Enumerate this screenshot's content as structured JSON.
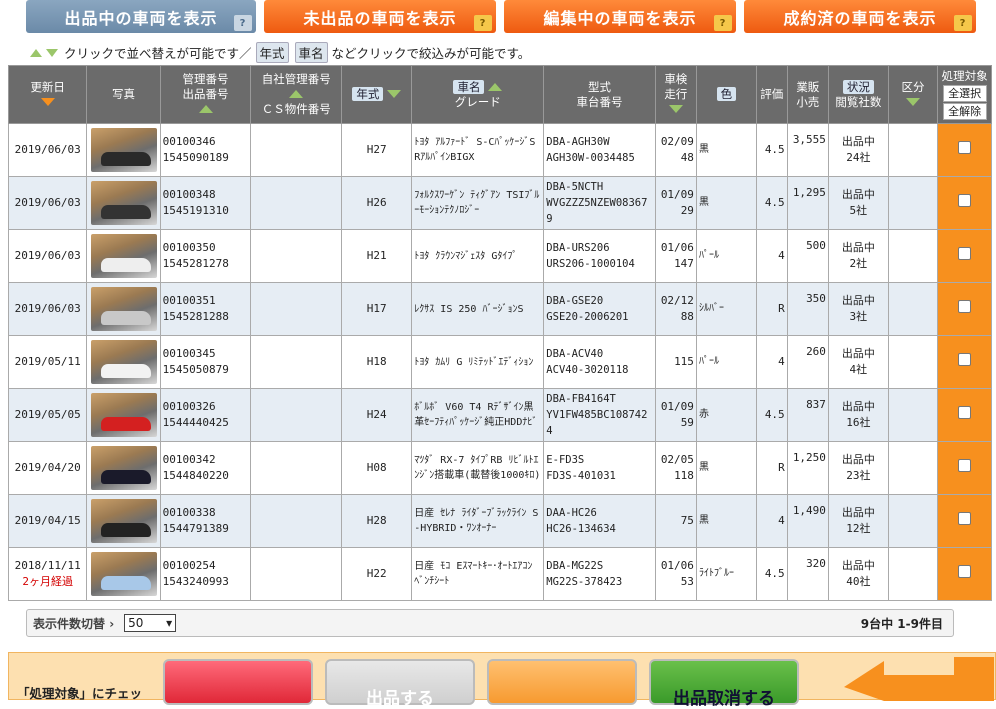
{
  "tabs": [
    {
      "label": "出品中の車両を表示",
      "icon": "help-badge-icon",
      "badge": "?",
      "active": true
    },
    {
      "label": "未出品の車両を表示",
      "icon": "help-badge-icon",
      "badge": "?",
      "active": false
    },
    {
      "label": "編集中の車両を表示",
      "icon": "help-badge-icon",
      "badge": "?",
      "active": false
    },
    {
      "label": "成約済の車両を表示",
      "icon": "help-badge-icon",
      "badge": "?",
      "active": false
    }
  ],
  "hint": {
    "part1": "クリックで並べ替えが可能です／",
    "chip1": "年式",
    "chip2": "車名",
    "part2": "などクリックで絞込みが可能です。"
  },
  "headers": {
    "updated": "更新日",
    "photo": "写真",
    "mgmt_no": "管理番号",
    "listing_no": "出品番号",
    "own_mgmt_no": "自社管理番号",
    "cs_no": "ＣＳ物件番号",
    "year": "年式",
    "car_name": "車名",
    "grade": "グレード",
    "model": "型式",
    "chassis": "車台番号",
    "inspection": "車検",
    "mileage": "走行",
    "color": "色",
    "rating": "評価",
    "sale": "業販",
    "retail": "小売",
    "status": "状況",
    "viewers": "閲覧社数",
    "category": "区分",
    "proc_target": "処理対象",
    "select_all": "全選択",
    "deselect_all": "全解除"
  },
  "rows": [
    {
      "updated": "2019/06/03",
      "updated_note": "",
      "mgmt": "00100346",
      "listing": "1545090189",
      "year": "H27",
      "grade": "ﾄﾖﾀ ｱﾙﾌｧｰﾄﾞ S-CﾊﾟｯｹｰｼﾞSRｱﾙﾊﾟｲﾝBIGX",
      "model": "DBA-AGH30W",
      "chassis": "AGH30W-0034485",
      "inspection": "02/09",
      "mileage": "48",
      "color": "黒",
      "rating": "4.5",
      "price": "3,555",
      "status": "出品中",
      "viewers": "24社",
      "car_color": "#2a2a2a"
    },
    {
      "updated": "2019/06/03",
      "updated_note": "",
      "mgmt": "00100348",
      "listing": "1545191310",
      "year": "H26",
      "grade": "ﾌｫﾙｸｽﾜｰｹﾞﾝ ﾃｨｸﾞｱﾝ TSIﾌﾞﾙｰﾓｰｼｮﾝﾃｸﾉﾛｼﾞｰ",
      "model": "DBA-5NCTH",
      "chassis": "WVGZZZ5NZEW083679",
      "inspection": "01/09",
      "mileage": "29",
      "color": "黒",
      "rating": "4.5",
      "price": "1,295",
      "status": "出品中",
      "viewers": "5社",
      "car_color": "#333333"
    },
    {
      "updated": "2019/06/03",
      "updated_note": "",
      "mgmt": "00100350",
      "listing": "1545281278",
      "year": "H21",
      "grade": "ﾄﾖﾀ ｸﾗｳﾝﾏｼﾞｪｽﾀ Gﾀｲﾌﾟ",
      "model": "DBA-URS206",
      "chassis": "URS206-1000104",
      "inspection": "01/06",
      "mileage": "147",
      "color": "ﾊﾟｰﾙ",
      "rating": "4",
      "price": "500",
      "status": "出品中",
      "viewers": "2社",
      "car_color": "#eeeeee"
    },
    {
      "updated": "2019/06/03",
      "updated_note": "",
      "mgmt": "00100351",
      "listing": "1545281288",
      "year": "H17",
      "grade": "ﾚｸｻｽ IS 250 ﾊﾞｰｼﾞｮﾝS",
      "model": "DBA-GSE20",
      "chassis": "GSE20-2006201",
      "inspection": "02/12",
      "mileage": "88",
      "color": "ｼﾙﾊﾞｰ",
      "rating": "R",
      "price": "350",
      "status": "出品中",
      "viewers": "3社",
      "car_color": "#c8c8c8"
    },
    {
      "updated": "2019/05/11",
      "updated_note": "",
      "mgmt": "00100345",
      "listing": "1545050879",
      "year": "H18",
      "grade": "ﾄﾖﾀ ｶﾑﾘ G ﾘﾐﾃｯﾄﾞｴﾃﾞｨｼｮﾝ",
      "model": "DBA-ACV40",
      "chassis": "ACV40-3020118",
      "inspection": "",
      "mileage": "115",
      "color": "ﾊﾟｰﾙ",
      "rating": "4",
      "price": "260",
      "status": "出品中",
      "viewers": "4社",
      "car_color": "#f2f2f2"
    },
    {
      "updated": "2019/05/05",
      "updated_note": "",
      "mgmt": "00100326",
      "listing": "1544440425",
      "year": "H24",
      "grade": "ﾎﾞﾙﾎﾞ V60 T4 Rﾃﾞｻﾞｲﾝ黒革ｾｰﾌﾃｨﾊﾟｯｹｰｼﾞ純正HDDﾅﾋﾞ",
      "model": "DBA-FB4164T",
      "chassis": "YV1FW485BC1087424",
      "inspection": "01/09",
      "mileage": "59",
      "color": "赤",
      "rating": "4.5",
      "price": "837",
      "status": "出品中",
      "viewers": "16社",
      "car_color": "#d42020"
    },
    {
      "updated": "2019/04/20",
      "updated_note": "",
      "mgmt": "00100342",
      "listing": "1544840220",
      "year": "H08",
      "grade": "ﾏﾂﾀﾞ RX-7 ﾀｲﾌﾟRB ﾘﾋﾞﾙﾄｴﾝｼﾞﾝ搭載車(載替後1000ｷﾛ)",
      "model": "E-FD3S",
      "chassis": "FD3S-401031",
      "inspection": "02/05",
      "mileage": "118",
      "color": "黒",
      "rating": "R",
      "price": "1,250",
      "status": "出品中",
      "viewers": "23社",
      "car_color": "#1a1a2a"
    },
    {
      "updated": "2019/04/15",
      "updated_note": "",
      "mgmt": "00100338",
      "listing": "1544791389",
      "year": "H28",
      "grade": "日産 ｾﾚﾅ ﾗｲﾀﾞｰﾌﾞﾗｯｸﾗｲﾝ S-HYBRID・ﾜﾝｵｰﾅｰ",
      "model": "DAA-HC26",
      "chassis": "HC26-134634",
      "inspection": "",
      "mileage": "75",
      "color": "黒",
      "rating": "4",
      "price": "1,490",
      "status": "出品中",
      "viewers": "12社",
      "car_color": "#222222"
    },
    {
      "updated": "2018/11/11",
      "updated_note": "2ヶ月経過",
      "mgmt": "00100254",
      "listing": "1543240993",
      "year": "H22",
      "grade": "日産 ﾓｺ Eｽﾏｰﾄｷｰ･ｵｰﾄｴｱｺﾝﾍﾞﾝﾁｼｰﾄ",
      "model": "DBA-MG22S",
      "chassis": "MG22S-378423",
      "inspection": "01/06",
      "mileage": "53",
      "color": "ﾗｲﾄﾌﾞﾙｰ",
      "rating": "4.5",
      "price": "320",
      "status": "出品中",
      "viewers": "40社",
      "car_color": "#a8c8e8"
    }
  ],
  "pager": {
    "label": "表示件数切替",
    "per_page": "50",
    "count_text": "9台中 1-9件目"
  },
  "bottom": {
    "note": "「処理対象」にチェッ",
    "btn1": "",
    "btn2": "出品する",
    "btn3": "",
    "btn4": "出品取消する"
  },
  "colors": {
    "active_tab": "#7996b2",
    "orange_tab": "#f26a1e",
    "header_bg": "#6b6b6b",
    "proc_col": "#f7901e",
    "row_alt": "#e6edf4"
  }
}
